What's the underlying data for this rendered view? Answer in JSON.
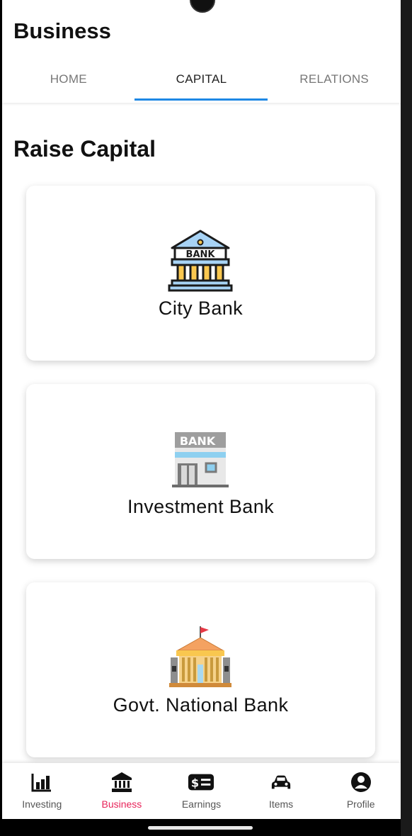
{
  "header": {
    "title": "Business"
  },
  "tabs": [
    {
      "label": "HOME"
    },
    {
      "label": "CAPITAL"
    },
    {
      "label": "RELATIONS"
    }
  ],
  "main": {
    "section_title": "Raise Capital",
    "cards": [
      {
        "label": "City Bank",
        "icon": "city-bank-icon"
      },
      {
        "label": "Investment Bank",
        "icon": "investment-bank-icon"
      },
      {
        "label": "Govt. National Bank",
        "icon": "national-bank-icon"
      }
    ],
    "bank_sign": "BANK"
  },
  "bottom_nav": [
    {
      "label": "Investing",
      "icon": "bar-chart-icon"
    },
    {
      "label": "Business",
      "icon": "bank-building-icon"
    },
    {
      "label": "Earnings",
      "icon": "money-bill-icon"
    },
    {
      "label": "Items",
      "icon": "car-icon"
    },
    {
      "label": "Profile",
      "icon": "user-circle-icon"
    }
  ],
  "colors": {
    "accent": "#1e88e5",
    "active_nav": "#e8245a"
  }
}
